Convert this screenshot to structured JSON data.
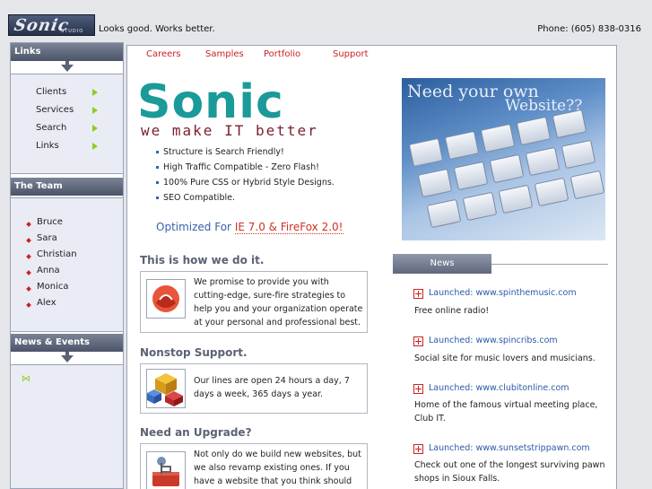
{
  "header": {
    "logo_text": "Sonic",
    "logo_sub": "STUDIO",
    "tagline": "Looks good. Works better.",
    "phone": "Phone: (605) 838-0316"
  },
  "sidebar": {
    "links_title": "Links",
    "links": [
      {
        "label": "Clients"
      },
      {
        "label": "Services"
      },
      {
        "label": "Search"
      },
      {
        "label": "Links"
      }
    ],
    "team_title": "The Team",
    "team": [
      {
        "label": "Bruce"
      },
      {
        "label": "Sara"
      },
      {
        "label": "Christian"
      },
      {
        "label": "Anna"
      },
      {
        "label": "Monica"
      },
      {
        "label": "Alex"
      }
    ],
    "news_events_title": "News & Events",
    "news_events_icon": "bowtie-icon"
  },
  "mainnav": {
    "items": [
      {
        "label": "Careers"
      },
      {
        "label": "Samples"
      },
      {
        "label": "Portfolio"
      },
      {
        "label": "Support"
      }
    ]
  },
  "hero": {
    "brand": "Sonic",
    "slogan": "we make IT better",
    "features": [
      "Structure is Search Friendly!",
      "High Traffic Compatible - Zero Flash!",
      "100% Pure CSS or Hybrid Style Designs.",
      "SEO Compatible."
    ],
    "optimized_prefix": "Optimized For ",
    "optimized_highlight": "IE 7.0 & FireFox 2.0!"
  },
  "sections": [
    {
      "title": "This is how we do it.",
      "text": "We promise to provide you with cutting-edge, sure-fire strategies to help you and your organization operate at your personal and professional best.",
      "icon": "ribbon-icon"
    },
    {
      "title": "Nonstop Support.",
      "text": "Our lines are open 24 hours a day, 7 days a week, 365 days a year.",
      "icon": "cubes-icon"
    },
    {
      "title": "Need an Upgrade?",
      "text": "Not only do we build new websites, but we also revamp existing ones. If you have a website that you think should look better or",
      "icon": "toolbox-icon"
    }
  ],
  "banner": {
    "line1": "Need your own",
    "line2": "Website??"
  },
  "news": {
    "tab": "News",
    "items": [
      {
        "link": "Launched: www.spinthemusic.com",
        "desc": "Free online radio!"
      },
      {
        "link": "Launched: www.spincribs.com",
        "desc": "Social site for music lovers and musicians."
      },
      {
        "link": "Launched: www.clubitonline.com",
        "desc": "Home of the famous virtual meeting place, Club IT."
      },
      {
        "link": "Launched: www.sunsetstrippawn.com",
        "desc": "Check out one of the longest surviving pawn shops in Sioux Falls."
      }
    ]
  }
}
